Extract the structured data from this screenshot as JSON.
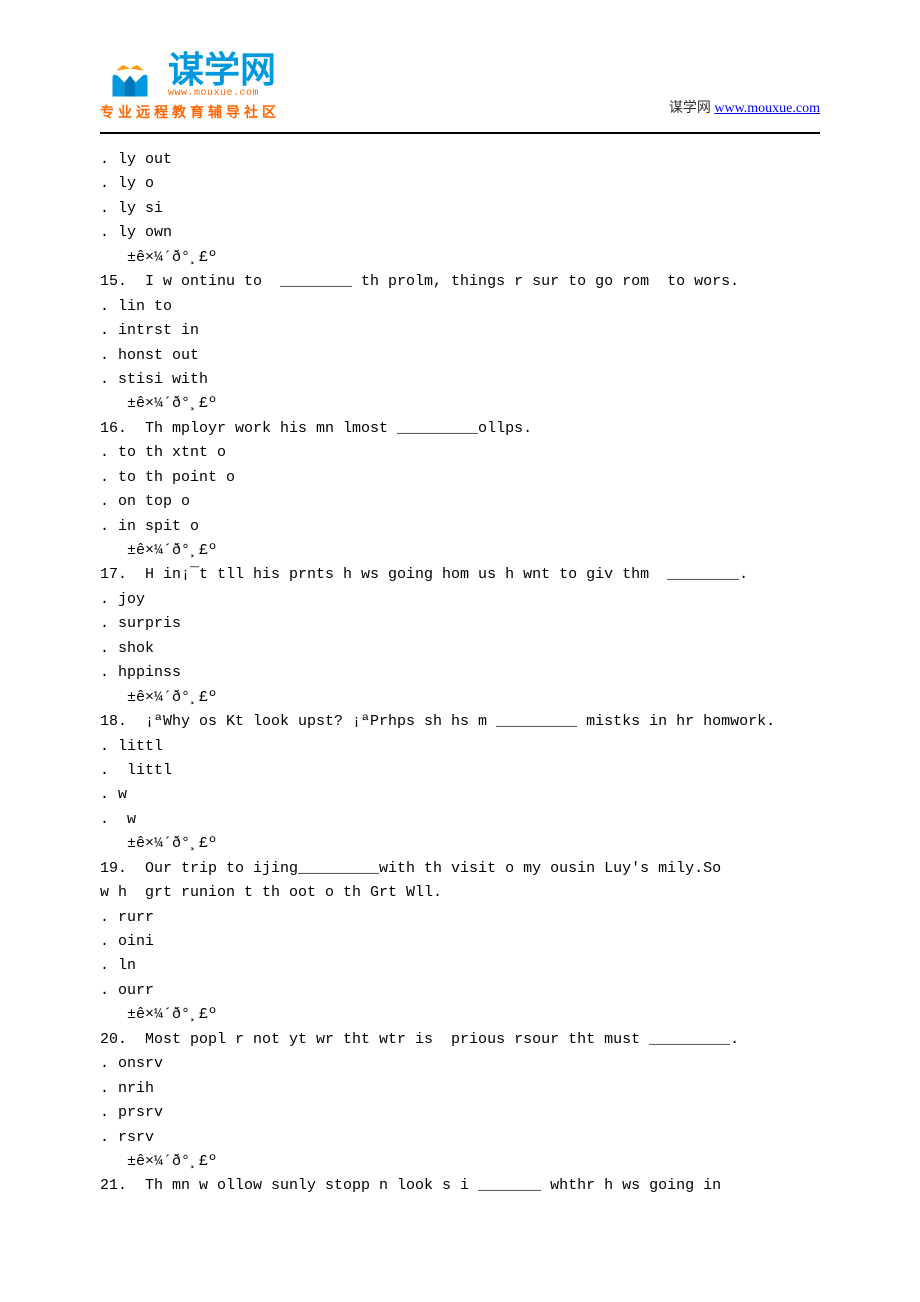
{
  "header": {
    "logo_chinese": "谋学网",
    "logo_url": "www.mouxue.com",
    "logo_subtitle": "专业远程教育辅导社区",
    "right_text": "谋学网",
    "right_link": "www.mouxue.com"
  },
  "content": {
    "lines": [
      ". ly out",
      ". ly o",
      ". ly si",
      ". ly own",
      "   ±ê×¼´ð°¸£º",
      "15.  I w ontinu to  ________ th prolm, things r sur to go rom  to wors.",
      ". lin to",
      ". intrst in",
      ". honst out",
      ". stisi with",
      "   ±ê×¼´ð°¸£º",
      "16.  Th mployr work his mn lmost _________ollps.",
      ". to th xtnt o",
      ". to th point o",
      ". on top o",
      ". in spit o",
      "   ±ê×¼´ð°¸£º",
      "17.  H in¡¯t tll his prnts h ws going hom us h wnt to giv thm  ________.",
      ". joy",
      ". surpris",
      ". shok",
      ". hppinss",
      "   ±ê×¼´ð°¸£º",
      "18.  ¡ªWhy os Kt look upst? ¡ªPrhps sh hs m _________ mistks in hr homwork.",
      ". littl",
      ".  littl",
      ". w",
      ".  w",
      "   ±ê×¼´ð°¸£º",
      "19.  Our trip to ijing_________with th visit o my ousin Luy's mily.So",
      "w h  grt runion t th oot o th Grt Wll.",
      ". rurr",
      ". oini",
      ". ln",
      ". ourr",
      "   ±ê×¼´ð°¸£º",
      "20.  Most popl r not yt wr tht wtr is  prious rsour tht must _________.",
      ". onsrv",
      ". nrih",
      ". prsrv",
      ". rsrv",
      "   ±ê×¼´ð°¸£º",
      "21.  Th mn w ollow sunly stopp n look s i _______ whthr h ws going in"
    ]
  }
}
